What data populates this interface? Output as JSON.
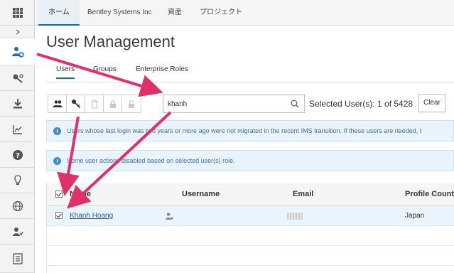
{
  "sidebar": {
    "items": [
      {
        "name": "apps-grid-icon"
      },
      {
        "name": "expand-chevron-icon"
      },
      {
        "name": "user-settings-icon"
      },
      {
        "name": "key-settings-icon"
      },
      {
        "name": "download-icon"
      },
      {
        "name": "chart-icon"
      },
      {
        "name": "help-icon"
      },
      {
        "name": "lightbulb-icon"
      },
      {
        "name": "globe-icon"
      },
      {
        "name": "user-check-icon"
      },
      {
        "name": "report-icon"
      }
    ]
  },
  "topbar": {
    "tabs": [
      {
        "label": "ホーム"
      },
      {
        "label": "Bentley Systems Inc"
      },
      {
        "label": "資産"
      },
      {
        "label": "プロジェクト"
      }
    ]
  },
  "page": {
    "title": "User Management",
    "subtabs": [
      {
        "label": "Users"
      },
      {
        "label": "Groups"
      },
      {
        "label": "Enterprise Roles"
      }
    ]
  },
  "search": {
    "value": "khanh",
    "selected_text": "Selected User(s): 1 of 5428",
    "clear_label": "Clear"
  },
  "info": {
    "message1": "Users whose last login was two years or more ago were not migrated in the recent IMS transition. If these users are needed, t",
    "message2": "Some user actions disabled based on selected user(s) role."
  },
  "table": {
    "headers": [
      "Name",
      "Username",
      "Email",
      "Profile Countr"
    ],
    "rows": [
      {
        "name": "Khanh Hoang",
        "country": "Japan",
        "checked": true
      }
    ]
  },
  "colors": {
    "accent": "#0a6ebd",
    "arrow": "#e0306a",
    "info_bg": "#e8f3fb"
  }
}
